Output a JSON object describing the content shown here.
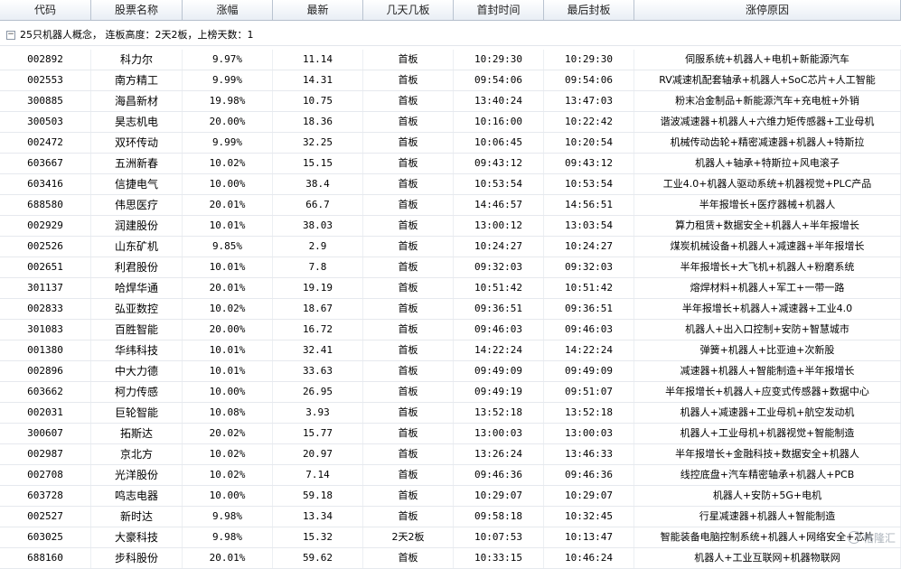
{
  "columns": [
    {
      "label": "代码",
      "w": 101
    },
    {
      "label": "股票名称",
      "w": 101
    },
    {
      "label": "涨幅",
      "w": 100
    },
    {
      "label": "最新",
      "w": 100
    },
    {
      "label": "几天几板",
      "w": 100
    },
    {
      "label": "首封时间",
      "w": 100
    },
    {
      "label": "最后封板",
      "w": 100
    },
    {
      "label": "涨停原因",
      "w": 295
    }
  ],
  "group": {
    "toggle": "−",
    "text": "25只机器人概念， 连板高度：2天2板，上榜天数：1"
  },
  "rows": [
    [
      "002892",
      "科力尔",
      "9.97%",
      "11.14",
      "首板",
      "10:29:30",
      "10:29:30",
      "伺服系统+机器人+电机+新能源汽车"
    ],
    [
      "002553",
      "南方精工",
      "9.99%",
      "14.31",
      "首板",
      "09:54:06",
      "09:54:06",
      "RV减速机配套轴承+机器人+SoC芯片+人工智能"
    ],
    [
      "300885",
      "海昌新材",
      "19.98%",
      "10.75",
      "首板",
      "13:40:24",
      "13:47:03",
      "粉末冶金制品+新能源汽车+充电桩+外销"
    ],
    [
      "300503",
      "昊志机电",
      "20.00%",
      "18.36",
      "首板",
      "10:16:00",
      "10:22:42",
      "谐波减速器+机器人+六维力矩传感器+工业母机"
    ],
    [
      "002472",
      "双环传动",
      "9.99%",
      "32.25",
      "首板",
      "10:06:45",
      "10:20:54",
      "机械传动齿轮+精密减速器+机器人+特斯拉"
    ],
    [
      "603667",
      "五洲新春",
      "10.02%",
      "15.15",
      "首板",
      "09:43:12",
      "09:43:12",
      "机器人+轴承+特斯拉+风电滚子"
    ],
    [
      "603416",
      "信捷电气",
      "10.00%",
      "38.4",
      "首板",
      "10:53:54",
      "10:53:54",
      "工业4.0+机器人驱动系统+机器视觉+PLC产品"
    ],
    [
      "688580",
      "伟思医疗",
      "20.01%",
      "66.7",
      "首板",
      "14:46:57",
      "14:56:51",
      "半年报增长+医疗器械+机器人"
    ],
    [
      "002929",
      "润建股份",
      "10.01%",
      "38.03",
      "首板",
      "13:00:12",
      "13:03:54",
      "算力租赁+数据安全+机器人+半年报增长"
    ],
    [
      "002526",
      "山东矿机",
      "9.85%",
      "2.9",
      "首板",
      "10:24:27",
      "10:24:27",
      "煤炭机械设备+机器人+减速器+半年报增长"
    ],
    [
      "002651",
      "利君股份",
      "10.01%",
      "7.8",
      "首板",
      "09:32:03",
      "09:32:03",
      "半年报增长+大飞机+机器人+粉磨系统"
    ],
    [
      "301137",
      "哈焊华通",
      "20.01%",
      "19.19",
      "首板",
      "10:51:42",
      "10:51:42",
      "熔焊材料+机器人+军工+一带一路"
    ],
    [
      "002833",
      "弘亚数控",
      "10.02%",
      "18.67",
      "首板",
      "09:36:51",
      "09:36:51",
      "半年报增长+机器人+减速器+工业4.0"
    ],
    [
      "301083",
      "百胜智能",
      "20.00%",
      "16.72",
      "首板",
      "09:46:03",
      "09:46:03",
      "机器人+出入口控制+安防+智慧城市"
    ],
    [
      "001380",
      "华纬科技",
      "10.01%",
      "32.41",
      "首板",
      "14:22:24",
      "14:22:24",
      "弹簧+机器人+比亚迪+次新股"
    ],
    [
      "002896",
      "中大力德",
      "10.01%",
      "33.63",
      "首板",
      "09:49:09",
      "09:49:09",
      "减速器+机器人+智能制造+半年报增长"
    ],
    [
      "603662",
      "柯力传感",
      "10.00%",
      "26.95",
      "首板",
      "09:49:19",
      "09:51:07",
      "半年报增长+机器人+应变式传感器+数据中心"
    ],
    [
      "002031",
      "巨轮智能",
      "10.08%",
      "3.93",
      "首板",
      "13:52:18",
      "13:52:18",
      "机器人+减速器+工业母机+航空发动机"
    ],
    [
      "300607",
      "拓斯达",
      "20.02%",
      "15.77",
      "首板",
      "13:00:03",
      "13:00:03",
      "机器人+工业母机+机器视觉+智能制造"
    ],
    [
      "002987",
      "京北方",
      "10.02%",
      "20.97",
      "首板",
      "13:26:24",
      "13:46:33",
      "半年报增长+金融科技+数据安全+机器人"
    ],
    [
      "002708",
      "光洋股份",
      "10.02%",
      "7.14",
      "首板",
      "09:46:36",
      "09:46:36",
      "线控底盘+汽车精密轴承+机器人+PCB"
    ],
    [
      "603728",
      "鸣志电器",
      "10.00%",
      "59.18",
      "首板",
      "10:29:07",
      "10:29:07",
      "机器人+安防+5G+电机"
    ],
    [
      "002527",
      "新时达",
      "9.98%",
      "13.34",
      "首板",
      "09:58:18",
      "10:32:45",
      "行星减速器+机器人+智能制造"
    ],
    [
      "603025",
      "大豪科技",
      "9.98%",
      "15.32",
      "2天2板",
      "10:07:53",
      "10:13:47",
      "智能装备电脑控制系统+机器人+网络安全+芯片"
    ],
    [
      "688160",
      "步科股份",
      "20.01%",
      "59.62",
      "首板",
      "10:33:15",
      "10:46:24",
      "机器人+工业互联网+机器物联网"
    ]
  ],
  "watermark": "格隆汇"
}
